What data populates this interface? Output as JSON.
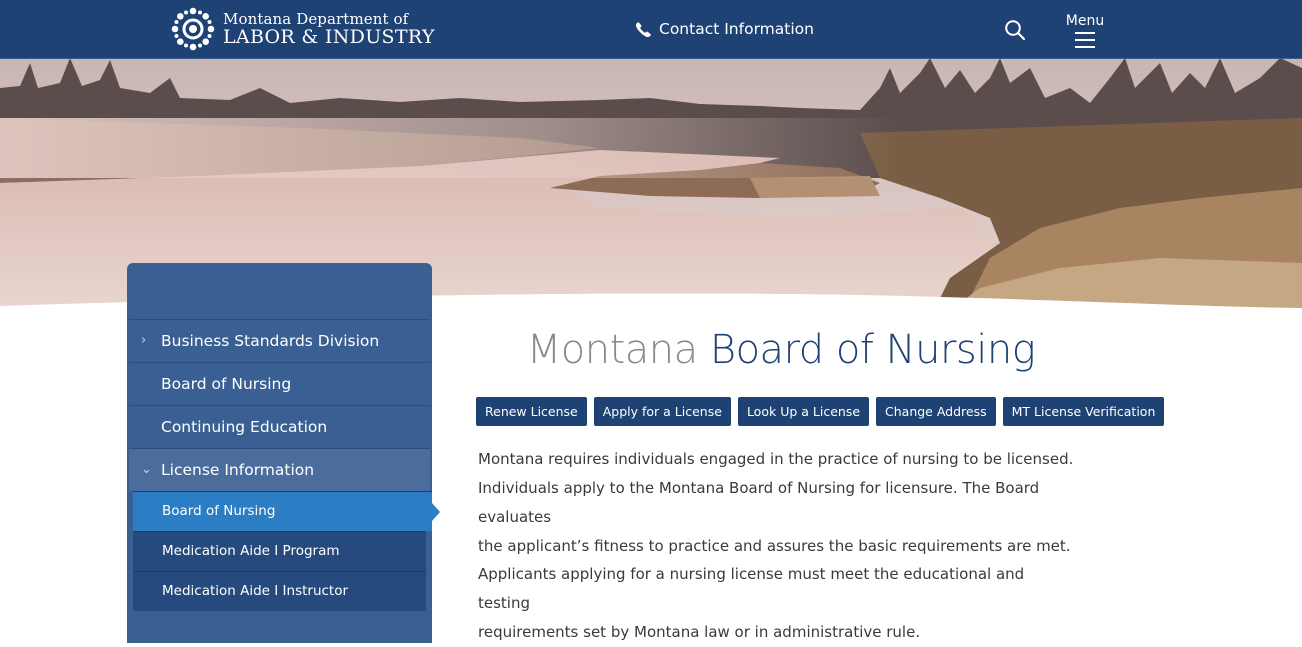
{
  "header": {
    "logo_line1": "Montana Department of",
    "logo_line2": "LABOR & INDUSTRY",
    "contact_label": "Contact Information",
    "menu_label": "Menu",
    "bg_color": "#1f4275"
  },
  "icons": {
    "logo": "montana-dli-seal-icon",
    "contact": "phone-icon",
    "search": "search-icon",
    "menu": "hamburger-icon"
  },
  "sidebar": {
    "items": [
      {
        "label": "Business Standards Division",
        "chevron": "›"
      },
      {
        "label": "Board of Nursing"
      },
      {
        "label": "Continuing Education"
      },
      {
        "label": "License Information",
        "chevron": "⌄"
      }
    ],
    "subitems": [
      {
        "label": "Board of Nursing",
        "active": true
      },
      {
        "label": "Medication Aide I Program"
      },
      {
        "label": "Medication Aide I Instructor"
      }
    ]
  },
  "main": {
    "title_part1": "Montana",
    "title_part2": "Board of Nursing",
    "buttons": [
      "Renew License",
      "Apply for a License",
      "Look Up a License",
      "Change Address",
      "MT License Verification"
    ],
    "para1_lines": [
      "Montana requires individuals engaged in the practice of nursing to be licensed.",
      "Individuals apply to the Montana Board of Nursing for licensure. The Board evaluates",
      "the applicant’s fitness to practice and assures the basic requirements are met."
    ],
    "para2_lines": [
      "Applicants applying for a nursing license must meet the educational and testing",
      "requirements set by Montana law or in administrative rule."
    ]
  }
}
